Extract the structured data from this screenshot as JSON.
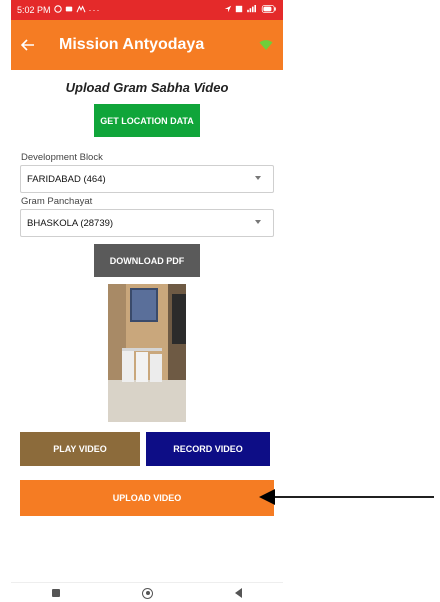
{
  "status_bar": {
    "time": "5:02 PM"
  },
  "app_bar": {
    "title": "Mission Antyodaya"
  },
  "page": {
    "heading": "Upload Gram Sabha Video"
  },
  "buttons": {
    "get_location": "GET LOCATION DATA",
    "download_pdf": "DOWNLOAD PDF",
    "play_video": "PLAY VIDEO",
    "record_video": "RECORD VIDEO",
    "upload_video": "UPLOAD VIDEO"
  },
  "fields": {
    "development_block": {
      "label": "Development Block",
      "value": "FARIDABAD (464)"
    },
    "gram_panchayat": {
      "label": "Gram Panchayat",
      "value": "BHASKOLA (28739)"
    }
  },
  "colors": {
    "status_bar": "#e42a2a",
    "app_bar": "#f57c23",
    "location_button": "#10a53a",
    "pdf_button": "#5a5a5a",
    "play_button": "#8c6b3b",
    "record_button": "#0d0d86",
    "upload_button": "#f57c23"
  },
  "icons": [
    "whatsapp-icon",
    "message-icon",
    "notification-icon",
    "navigation-icon",
    "signal-icon",
    "battery-icon",
    "back-arrow-icon",
    "wifi-icon",
    "caret-down-icon",
    "nav-recents-icon",
    "nav-home-icon",
    "nav-back-icon"
  ]
}
